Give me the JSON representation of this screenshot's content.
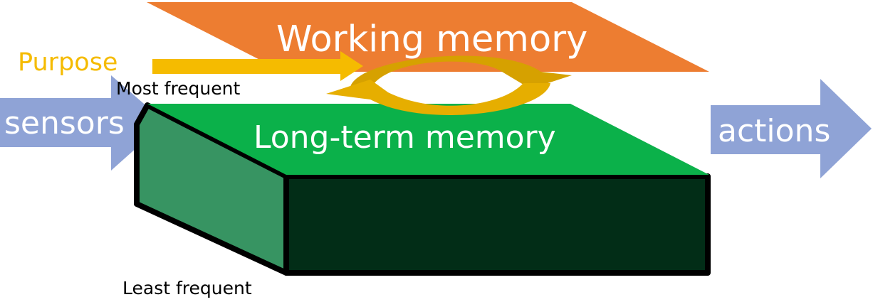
{
  "diagram": {
    "working_memory": {
      "label": "Working memory",
      "color": "#ed7d31"
    },
    "long_term_memory": {
      "label": "Long-term memory",
      "top_color": "#0bb14a",
      "side_color": "#379462",
      "front_color": "#022d17"
    },
    "inputs": {
      "sensors": {
        "label": "sensors",
        "color": "#8fa3d6"
      },
      "purpose": {
        "label": "Purpose",
        "color": "#f5bb00"
      }
    },
    "outputs": {
      "actions": {
        "label": "actions",
        "color": "#8fa3d6"
      }
    },
    "frequency": {
      "most": "Most frequent",
      "least": "Least frequent"
    },
    "cycle_arrows": {
      "color": "#f5b800"
    }
  }
}
